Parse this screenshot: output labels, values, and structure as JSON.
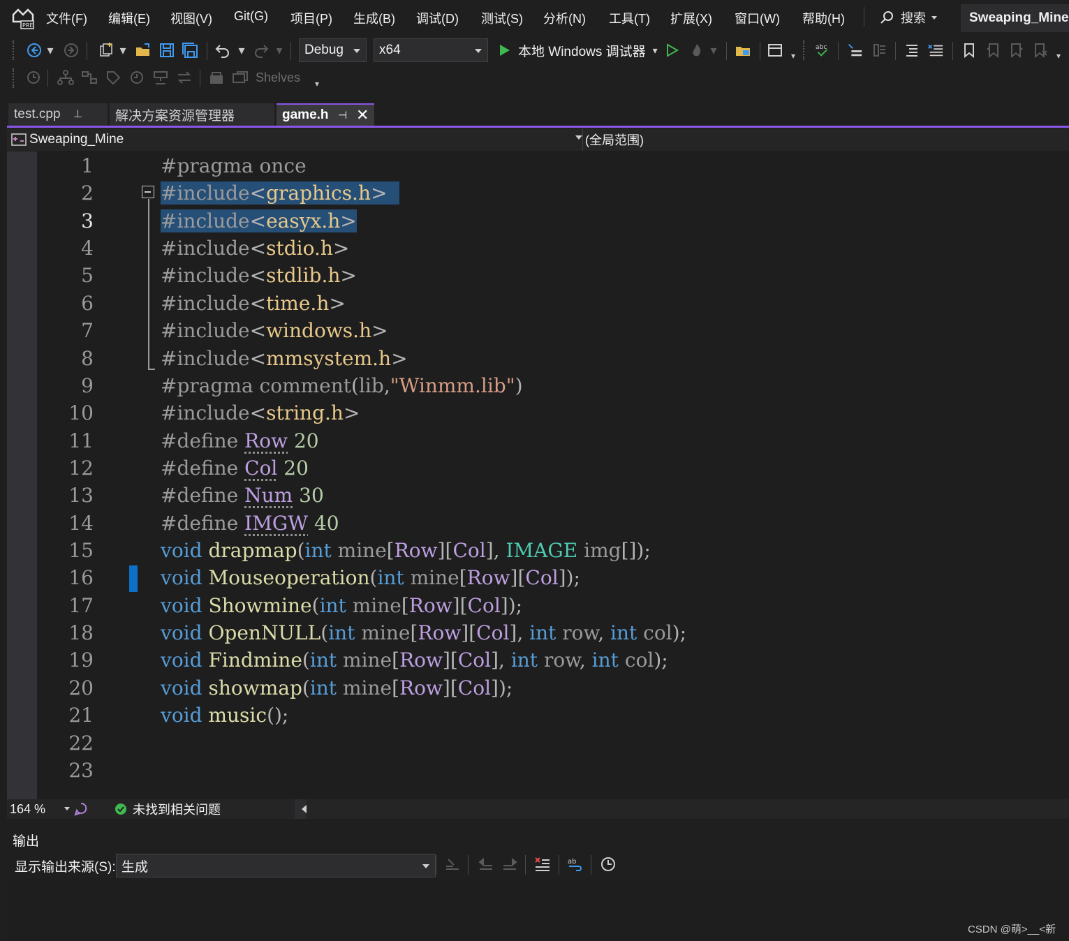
{
  "menu": {
    "items": [
      "文件(F)",
      "编辑(E)",
      "视图(V)",
      "Git(G)",
      "项目(P)",
      "生成(B)",
      "调试(D)",
      "测试(S)",
      "分析(N)",
      "工具(T)",
      "扩展(X)",
      "窗口(W)",
      "帮助(H)"
    ],
    "search_label": "搜索",
    "project_name": "Sweaping_Mine",
    "logo_badge": "PRE"
  },
  "toolbar": {
    "config": "Debug",
    "platform": "x64",
    "run_label": "本地 Windows 调试器",
    "shelves_label": "Shelves"
  },
  "tabs": [
    {
      "label": "test.cpp",
      "active": false
    },
    {
      "label": "解决方案资源管理器",
      "active": false
    },
    {
      "label": "game.h",
      "active": true
    }
  ],
  "navbar": {
    "project_scope": "Sweaping_Mine",
    "scope": "(全局范围)"
  },
  "editor": {
    "current_line": 3,
    "line_numbers": [
      "1",
      "2",
      "3",
      "4",
      "5",
      "6",
      "7",
      "8",
      "9",
      "10",
      "11",
      "12",
      "13",
      "14",
      "15",
      "16",
      "17",
      "18",
      "19",
      "20",
      "21",
      "22",
      "23"
    ],
    "lines": [
      "#pragma once",
      "#include<graphics.h>",
      "#include<easyx.h>",
      "#include<stdio.h>",
      "#include<stdlib.h>",
      "#include<time.h>",
      "#include<windows.h>",
      "#include<mmsystem.h>",
      "#pragma comment(lib,\"Winmm.lib\")",
      "#include<string.h>",
      "#define Row 20",
      "#define Col 20",
      "#define Num 30",
      "#define IMGW 40",
      "void drapmap(int mine[Row][Col], IMAGE img[]);",
      "void Mouseoperation(int mine[Row][Col]);",
      "void Showmine(int mine[Row][Col]);",
      "void OpenNULL(int mine[Row][Col], int row, int col);",
      "void Findmine(int mine[Row][Col], int row, int col);",
      "void showmap(int mine[Row][Col]);",
      "void music();",
      "",
      ""
    ]
  },
  "status": {
    "zoom": "164 %",
    "issues": "未找到相关问题"
  },
  "output": {
    "title": "输出",
    "source_label": "显示输出来源(S):",
    "source_value": "生成"
  },
  "watermark": "CSDN @萌>__<新",
  "colors": {
    "accent": "#8957e5",
    "selection": "#264f78",
    "keyword": "#569cd6",
    "function": "#dcdcaa",
    "macro": "#bd9fe0",
    "include_path": "#e8c98b",
    "type": "#4ec9b0",
    "ok": "#3fb950"
  }
}
